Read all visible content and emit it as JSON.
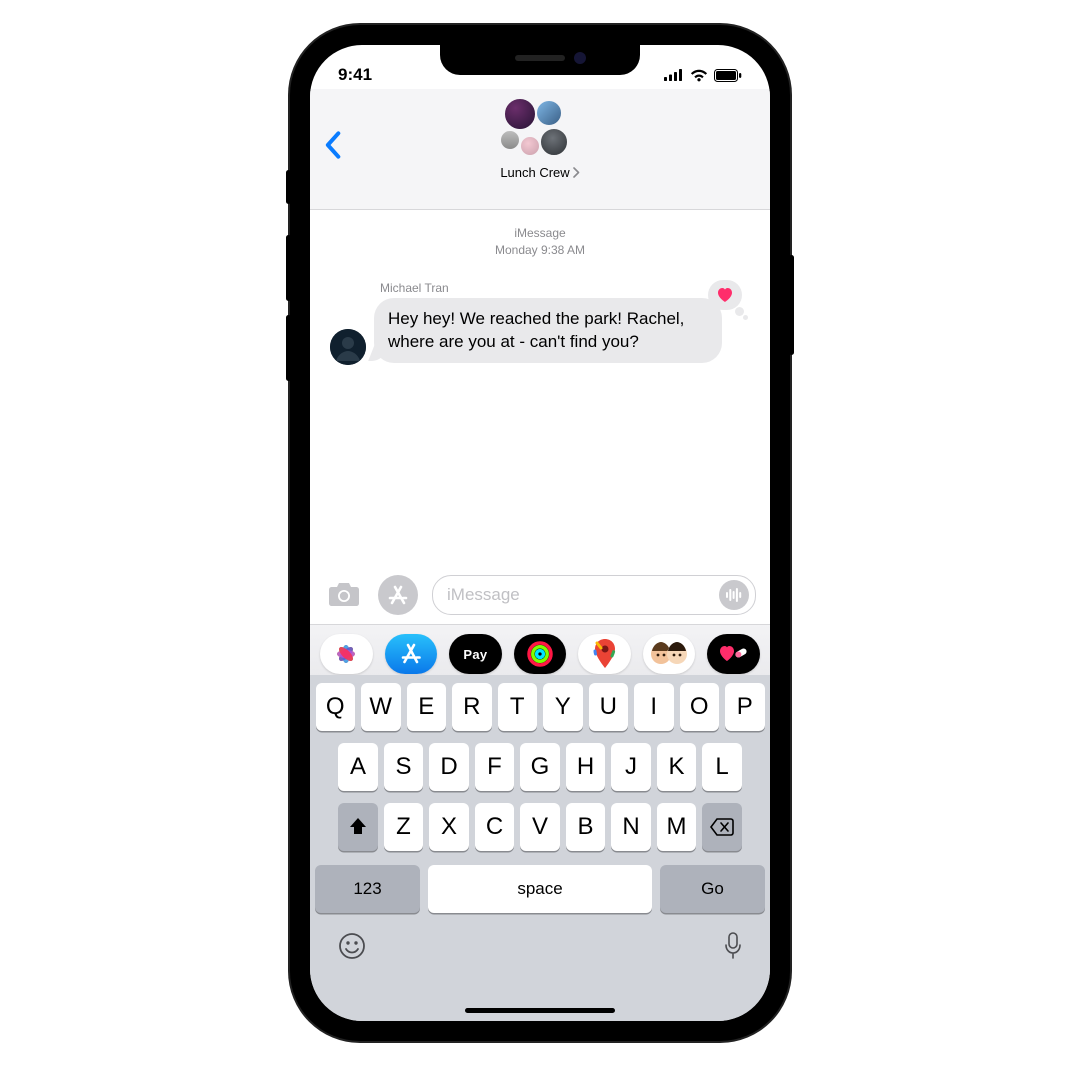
{
  "status": {
    "time": "9:41"
  },
  "header": {
    "group_name": "Lunch Crew"
  },
  "thread": {
    "service": "iMessage",
    "timestamp": "Monday 9:38 AM",
    "msg1": {
      "sender": "Michael Tran",
      "text": "Hey hey! We reached the park! Rachel, where are you at - can't find you?"
    }
  },
  "compose": {
    "placeholder": "iMessage"
  },
  "apps": {
    "applepay": "Pay"
  },
  "keyboard": {
    "row1": [
      "Q",
      "W",
      "E",
      "R",
      "T",
      "Y",
      "U",
      "I",
      "O",
      "P"
    ],
    "row2": [
      "A",
      "S",
      "D",
      "F",
      "G",
      "H",
      "J",
      "K",
      "L"
    ],
    "row3": [
      "Z",
      "X",
      "C",
      "V",
      "B",
      "N",
      "M"
    ],
    "numkey": "123",
    "space": "space",
    "go": "Go"
  }
}
